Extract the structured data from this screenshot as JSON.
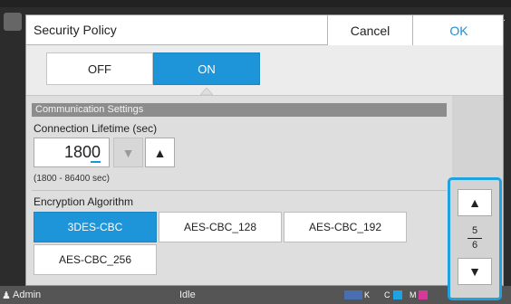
{
  "background": {
    "right_text": "y.",
    "user": "Admin",
    "status": "Idle",
    "ink_labels": [
      "K",
      "C",
      "M"
    ]
  },
  "dialog": {
    "title": "Security Policy",
    "cancel_label": "Cancel",
    "ok_label": "OK"
  },
  "toggle": {
    "off_label": "OFF",
    "on_label": "ON",
    "selected": "ON"
  },
  "settings": {
    "section_title": "Communication Settings",
    "lifetime_label": "Connection Lifetime (sec)",
    "lifetime_value": "1800",
    "lifetime_range": "(1800 - 86400 sec)",
    "algorithm_label": "Encryption Algorithm",
    "algorithms": [
      "3DES-CBC",
      "AES-CBC_128",
      "AES-CBC_192",
      "AES-CBC_256"
    ],
    "selected_algorithm": "3DES-CBC"
  },
  "scroll": {
    "current_page": "5",
    "total_pages": "6"
  },
  "colors": {
    "accent": "#1e95d8",
    "ok_text": "#1c8fd6",
    "highlight": "#1ea3e0"
  }
}
